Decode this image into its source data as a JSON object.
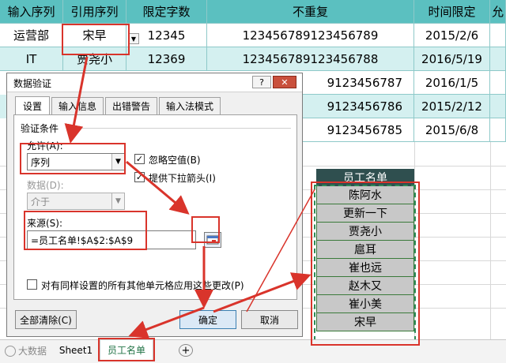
{
  "sheet": {
    "headers": [
      "输入序列",
      "引用序列",
      "限定字数",
      "不重复",
      "时间限定",
      "允"
    ],
    "rows": [
      [
        "运营部",
        "宋早",
        "12345",
        "123456789123456789",
        "2015/2/6"
      ],
      [
        "IT",
        "贾尧小",
        "12369",
        "123456789123456788",
        "2016/5/19"
      ],
      [
        "",
        "",
        "",
        "9123456787",
        "2016/1/5"
      ],
      [
        "",
        "",
        "",
        "9123456786",
        "2015/2/12"
      ],
      [
        "",
        "",
        "",
        "9123456785",
        "2015/6/8"
      ]
    ]
  },
  "employee_list": {
    "header": "员工名单",
    "items": [
      "陈阿水",
      "更新一下",
      "贾尧小",
      "扈耳",
      "崔也远",
      "赵木又",
      "崔小美",
      "宋早"
    ]
  },
  "dialog": {
    "title": "数据验证",
    "help_label": "?",
    "close_label": "✕",
    "tabs": [
      "设置",
      "输入信息",
      "出错警告",
      "输入法模式"
    ],
    "section_title": "验证条件",
    "allow_label": "允许(A):",
    "allow_value": "序列",
    "ignore_blank_label": "忽略空值(B)",
    "dropdown_label": "提供下拉箭头(I)",
    "data_label": "数据(D):",
    "data_value": "介于",
    "source_label": "来源(S):",
    "source_value": "=员工名单!$A$2:$A$9",
    "apply_all_label": "对有同样设置的所有其他单元格应用这些更改(P)",
    "clear_all_label": "全部清除(C)",
    "ok_label": "确定",
    "cancel_label": "取消"
  },
  "sheet_tabs": {
    "sheet1": "Sheet1",
    "employee": "员工名单",
    "add": "+"
  },
  "watermark": "大数据",
  "colors": {
    "header_bg": "#5bc0c0",
    "alt_row_bg": "#d4f0f0",
    "annotation_red": "#d9342b",
    "list_header_bg": "#2f4f4f"
  }
}
